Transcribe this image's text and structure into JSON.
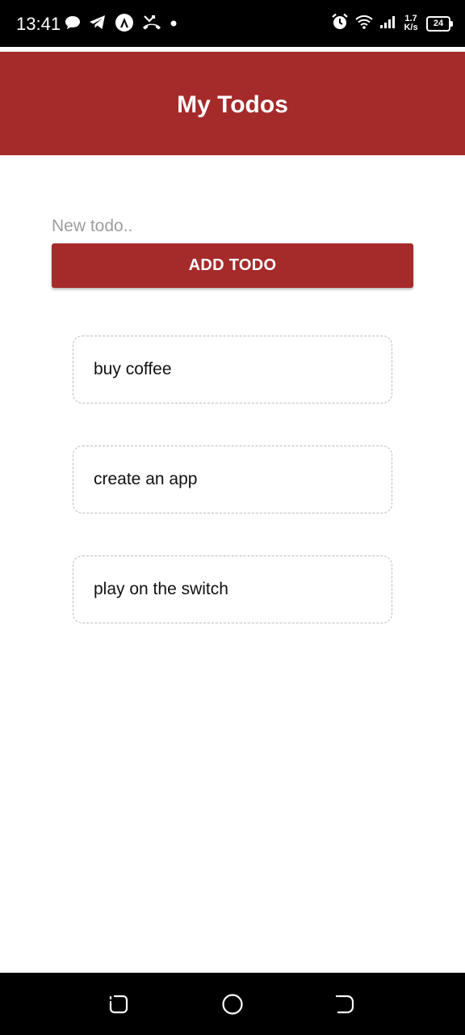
{
  "status_bar": {
    "time": "13:41",
    "net_speed_value": "1.7",
    "net_speed_unit": "K/s",
    "battery_level": "24",
    "left_icons": [
      "chat-bubble-icon",
      "telegram-icon",
      "app-a-icon",
      "missed-call-icon",
      "dot-icon"
    ],
    "right_icons": [
      "alarm-icon",
      "wifi-icon",
      "signal-icon",
      "battery-icon"
    ]
  },
  "header": {
    "title": "My Todos",
    "background_color": "#a52a2a"
  },
  "form": {
    "input_placeholder": "New todo..",
    "input_value": "",
    "add_button_label": "ADD TODO"
  },
  "todos": [
    {
      "text": "buy coffee"
    },
    {
      "text": "create an app"
    },
    {
      "text": "play on the switch"
    }
  ],
  "nav_bar": {
    "buttons": [
      "recents-icon",
      "home-icon",
      "back-icon"
    ]
  },
  "colors": {
    "accent": "#a52a2a",
    "placeholder": "#9e9e9e",
    "item_border": "#bdbdbd"
  }
}
